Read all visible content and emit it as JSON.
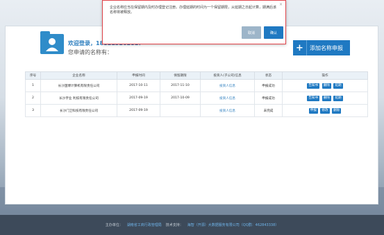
{
  "welcome": {
    "line1": "欢迎登录，18821326281！",
    "line2": "您申请的名称有："
  },
  "apply_button": {
    "label": "添加名称申报"
  },
  "table": {
    "headers": [
      "序号",
      "企业名称",
      "申报时间",
      "保留期限",
      "投资人(子公司)信息",
      "状态",
      "操作"
    ],
    "rows": [
      {
        "no": "1",
        "name": "长沙国博计算机有限责任公司",
        "date": "2017-10-11",
        "expiry": "2017-11-10",
        "investor": "投资人信息",
        "status": "申报成功",
        "ops": [
          "告知书",
          "删除",
          "延期"
        ]
      },
      {
        "no": "2",
        "name": "长沙宇业 利技有限责任公司",
        "date": "2017-09-19",
        "expiry": "2017-10-09",
        "investor": "投资人信息",
        "status": "申报成功",
        "ops": [
          "告知书",
          "删除",
          "延期"
        ]
      },
      {
        "no": "3",
        "name": "长沙门卫科技有限责任公司",
        "date": "2017-09-19",
        "expiry": "",
        "investor": "投资人信息",
        "status": "未完成",
        "ops": [
          "申报",
          "修改",
          "删除"
        ]
      }
    ]
  },
  "footer": {
    "host_label": "主办单位：",
    "host": "湖南省工商行政管理局",
    "support_label": "技术支持：",
    "support": "海智（开源）大数据服务有限公司（QQ群：462843338）"
  },
  "dialog": {
    "message": "企业名称应当在保留期内及时办理登记注册。办理延期的时间为一个保留期限，从延期之日起计算，期满后该名称将被释放。",
    "cancel_label": "取消",
    "ok_label": "确认",
    "close_glyph": "×"
  },
  "colors": {
    "accent": "#1f79c2",
    "dialog_border": "#e0444a",
    "footer_bg": "#3d4a5a"
  }
}
